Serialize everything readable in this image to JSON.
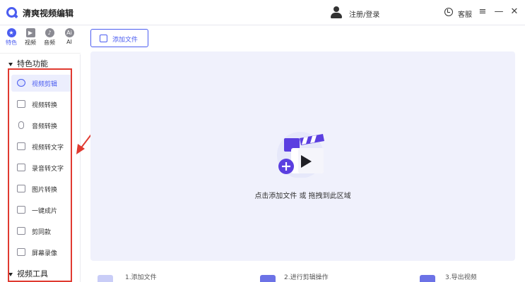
{
  "app": {
    "title": "清爽视频编辑"
  },
  "header": {
    "login": "注册/登录",
    "service": "客服"
  },
  "icon_rail": [
    {
      "label": "特色",
      "icon": "star-icon",
      "glyph": "★"
    },
    {
      "label": "视频",
      "icon": "film-icon",
      "glyph": "▶"
    },
    {
      "label": "音频",
      "icon": "audio-icon",
      "glyph": "♪"
    },
    {
      "label": "AI",
      "icon": "ai-icon",
      "glyph": "Ai"
    }
  ],
  "sidebar": {
    "section1": "特色功能",
    "items": [
      {
        "label": "视频剪辑",
        "icon": "video-edit-icon"
      },
      {
        "label": "视频转换",
        "icon": "video-convert-icon"
      },
      {
        "label": "音频转换",
        "icon": "microphone-icon"
      },
      {
        "label": "视频转文字",
        "icon": "video-to-text-icon"
      },
      {
        "label": "录音转文字",
        "icon": "recording-to-text-icon"
      },
      {
        "label": "图片转换",
        "icon": "image-convert-icon"
      },
      {
        "label": "一键成片",
        "icon": "one-click-video-icon"
      },
      {
        "label": "剪同款",
        "icon": "template-icon"
      },
      {
        "label": "屏幕录像",
        "icon": "screen-record-icon"
      }
    ],
    "section2": "视频工具"
  },
  "toolbar": {
    "add_file": "添加文件"
  },
  "drop_zone": {
    "text": "点击添加文件 或 拖拽到此区域"
  },
  "steps": [
    "1.添加文件",
    "2.进行剪辑操作",
    "3.导出视频"
  ],
  "colors": {
    "accent": "#4b5df0",
    "annotation": "#e03a30",
    "dropzone_bg": "#f0f1fc"
  }
}
